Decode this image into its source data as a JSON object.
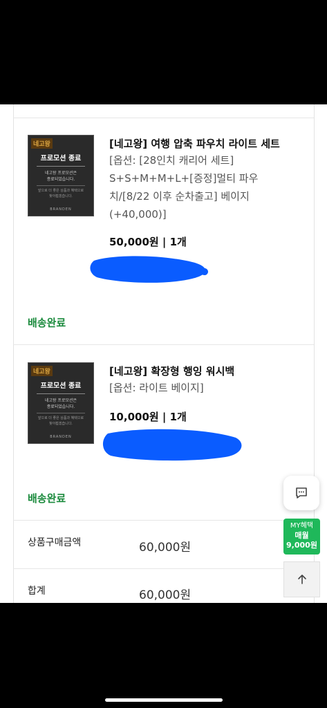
{
  "items": [
    {
      "title": "[네고왕] 여행 압축 파우치 라이트 세트",
      "option_lines": [
        "[옵션: [28인치 캐리어 세트]",
        "S+S+M+M+L+[증정]멀티 파우",
        "치/[8/22 이후 순차출고] 베이지",
        "(+40,000)]"
      ],
      "price": "50,000원 | 1개",
      "status": "배송완료",
      "thumb": {
        "logo": "네고왕",
        "promo": "프로모션 종료",
        "text": "네고왕 프로모션은\n종료되었습니다.",
        "small": "앞으로 더 좋은 상품과 혜택으로\n찾아뵙겠습니다.",
        "brand": "BRANDEN"
      }
    },
    {
      "title": "[네고왕] 확장형 행잉 워시백",
      "option_lines": [
        "[옵션: 라이트 베이지]"
      ],
      "price": "10,000원 | 1개",
      "status": "배송완료",
      "thumb": {
        "logo": "네고왕",
        "promo": "프로모션 종료",
        "text": "네고왕 프로모션은\n종료되었습니다.",
        "small": "앞으로 더 좋은 상품과 혜택으로\n찾아뵙겠습니다.",
        "brand": "BRANDEN"
      }
    }
  ],
  "summary": {
    "purchase_label": "상품구매금액",
    "purchase_value": "60,000원",
    "total_label": "합계",
    "total_value": "60,000원"
  },
  "floating": {
    "chat_icon": "chat-icon",
    "my_label": "MY혜택",
    "my_sub": "매월",
    "my_amount": "9,000원",
    "top_icon": "arrow-up-icon"
  },
  "colors": {
    "status_green": "#1a8a3c",
    "my_green": "#1fb85a",
    "redaction_blue": "#0a5cff"
  }
}
